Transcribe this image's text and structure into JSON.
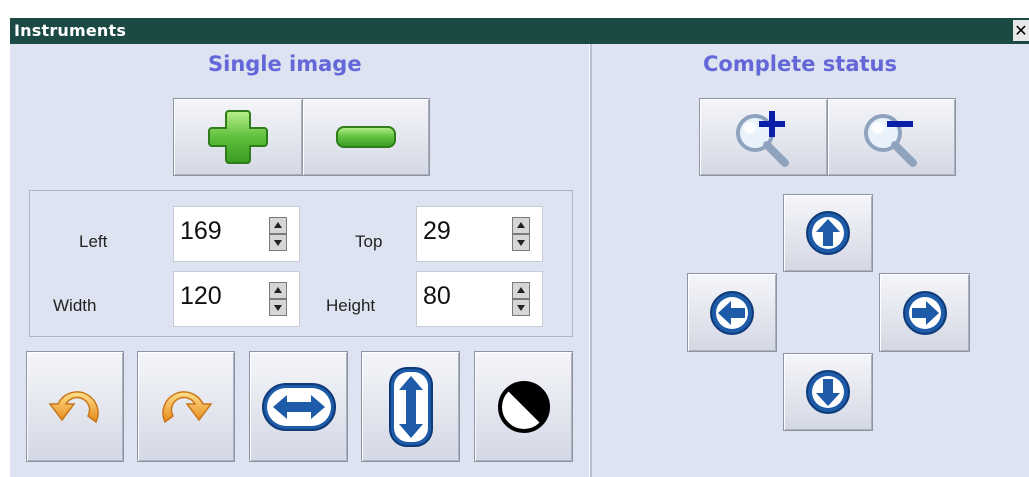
{
  "window": {
    "title": "Instruments",
    "close_glyph": "✕"
  },
  "single_image": {
    "title": "Single image",
    "zoom_buttons": [
      {
        "name": "enlarge",
        "icon": "green-plus-icon"
      },
      {
        "name": "reduce",
        "icon": "green-minus-icon"
      }
    ],
    "fields": {
      "left": {
        "label": "Left",
        "value": "169"
      },
      "top": {
        "label": "Top",
        "value": "29"
      },
      "width": {
        "label": "Width",
        "value": "120"
      },
      "height": {
        "label": "Height",
        "value": "80"
      }
    },
    "tools": [
      {
        "name": "rotate-left",
        "icon": "rotate-left-arrow-icon"
      },
      {
        "name": "rotate-right",
        "icon": "rotate-right-arrow-icon"
      },
      {
        "name": "flip-horizontal",
        "icon": "horizontal-double-arrow-icon"
      },
      {
        "name": "flip-vertical",
        "icon": "vertical-double-arrow-icon"
      },
      {
        "name": "invert",
        "icon": "half-black-circle-icon"
      }
    ]
  },
  "complete_status": {
    "title": "Complete status",
    "zoom_buttons": [
      {
        "name": "zoom-in",
        "icon": "magnifier-plus-icon"
      },
      {
        "name": "zoom-out",
        "icon": "magnifier-minus-icon"
      }
    ],
    "pan_buttons": [
      "up",
      "left",
      "right",
      "down"
    ]
  },
  "colors": {
    "titlebar": "#1b4a45",
    "panel": "#dde3f0",
    "section_title": "#6467d8",
    "green": "#5fc03c",
    "orange": "#f2a53a",
    "blue": "#1e5ba8"
  }
}
